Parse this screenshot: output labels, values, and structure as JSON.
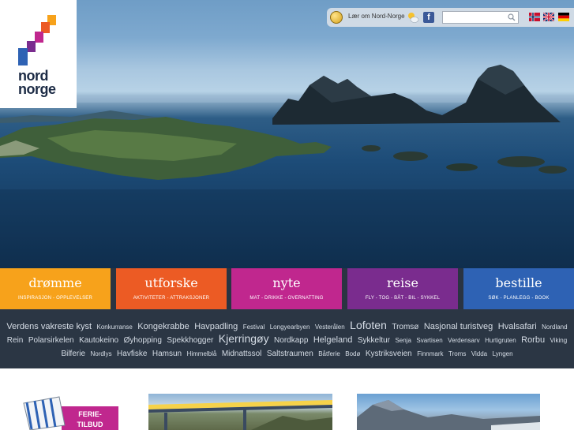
{
  "logo": {
    "line1": "nord",
    "line2": "norge"
  },
  "topbar": {
    "learn_link": "Lær om Nord-Norge",
    "search_placeholder": "",
    "flags": [
      "norwegian-flag",
      "english-flag",
      "german-flag"
    ]
  },
  "tiles": [
    {
      "title": "drømme",
      "subtitle": "INSPIRASJON - OPPLEVELSER",
      "color": "#f7a21b"
    },
    {
      "title": "utforske",
      "subtitle": "AKTIVITETER - ATTRAKSJONER",
      "color": "#ec5b24"
    },
    {
      "title": "nyte",
      "subtitle": "MAT - DRIKKE - OVERNATTING",
      "color": "#c0278e"
    },
    {
      "title": "reise",
      "subtitle": "FLY - TOG - BÅT - BIL - SYKKEL",
      "color": "#7a2c8e"
    },
    {
      "title": "bestille",
      "subtitle": "SØK - PLANLEGG - BOOK",
      "color": "#2e62b4"
    }
  ],
  "tag_cloud": [
    {
      "text": "Verdens vakreste kyst",
      "size": 11
    },
    {
      "text": "Konkurranse",
      "size": 8
    },
    {
      "text": "Kongekrabbe",
      "size": 11
    },
    {
      "text": "Havpadling",
      "size": 11
    },
    {
      "text": "Festival",
      "size": 8
    },
    {
      "text": "Longyearbyen",
      "size": 8
    },
    {
      "text": "Vesterålen",
      "size": 8
    },
    {
      "text": "Lofoten",
      "size": 14
    },
    {
      "text": "Tromsø",
      "size": 10
    },
    {
      "text": "Nasjonal turistveg",
      "size": 11
    },
    {
      "text": "Hvalsafari",
      "size": 11
    },
    {
      "text": "Nordland",
      "size": 8
    },
    {
      "text": "Rein",
      "size": 10
    },
    {
      "text": "Polarsirkelen",
      "size": 10
    },
    {
      "text": "Kautokeino",
      "size": 10
    },
    {
      "text": "Øyhopping",
      "size": 10
    },
    {
      "text": "Spekkhogger",
      "size": 10
    },
    {
      "text": "Kjerringøy",
      "size": 14
    },
    {
      "text": "Nordkapp",
      "size": 10
    },
    {
      "text": "Helgeland",
      "size": 11
    },
    {
      "text": "Sykkeltur",
      "size": 10
    },
    {
      "text": "Senja",
      "size": 8
    },
    {
      "text": "Svartisen",
      "size": 8
    },
    {
      "text": "Verdensarv",
      "size": 8
    },
    {
      "text": "Hurtigruten",
      "size": 8
    },
    {
      "text": "Rorbu",
      "size": 11
    },
    {
      "text": "Viking",
      "size": 8
    },
    {
      "text": "Bilferie",
      "size": 10
    },
    {
      "text": "Nordlys",
      "size": 8
    },
    {
      "text": "Havfiske",
      "size": 10
    },
    {
      "text": "Hamsun",
      "size": 10
    },
    {
      "text": "Himmelblå",
      "size": 8
    },
    {
      "text": "Midnattssol",
      "size": 10
    },
    {
      "text": "Saltstraumen",
      "size": 10
    },
    {
      "text": "Båtferie",
      "size": 8
    },
    {
      "text": "Bodø",
      "size": 8
    },
    {
      "text": "Kystriksveien",
      "size": 10
    },
    {
      "text": "Finnmark",
      "size": 8
    },
    {
      "text": "Troms",
      "size": 8
    },
    {
      "text": "Vidda",
      "size": 8
    },
    {
      "text": "Lyngen",
      "size": 8
    }
  ],
  "promo": {
    "line1": "FERIE-",
    "line2": "TILBUD"
  }
}
